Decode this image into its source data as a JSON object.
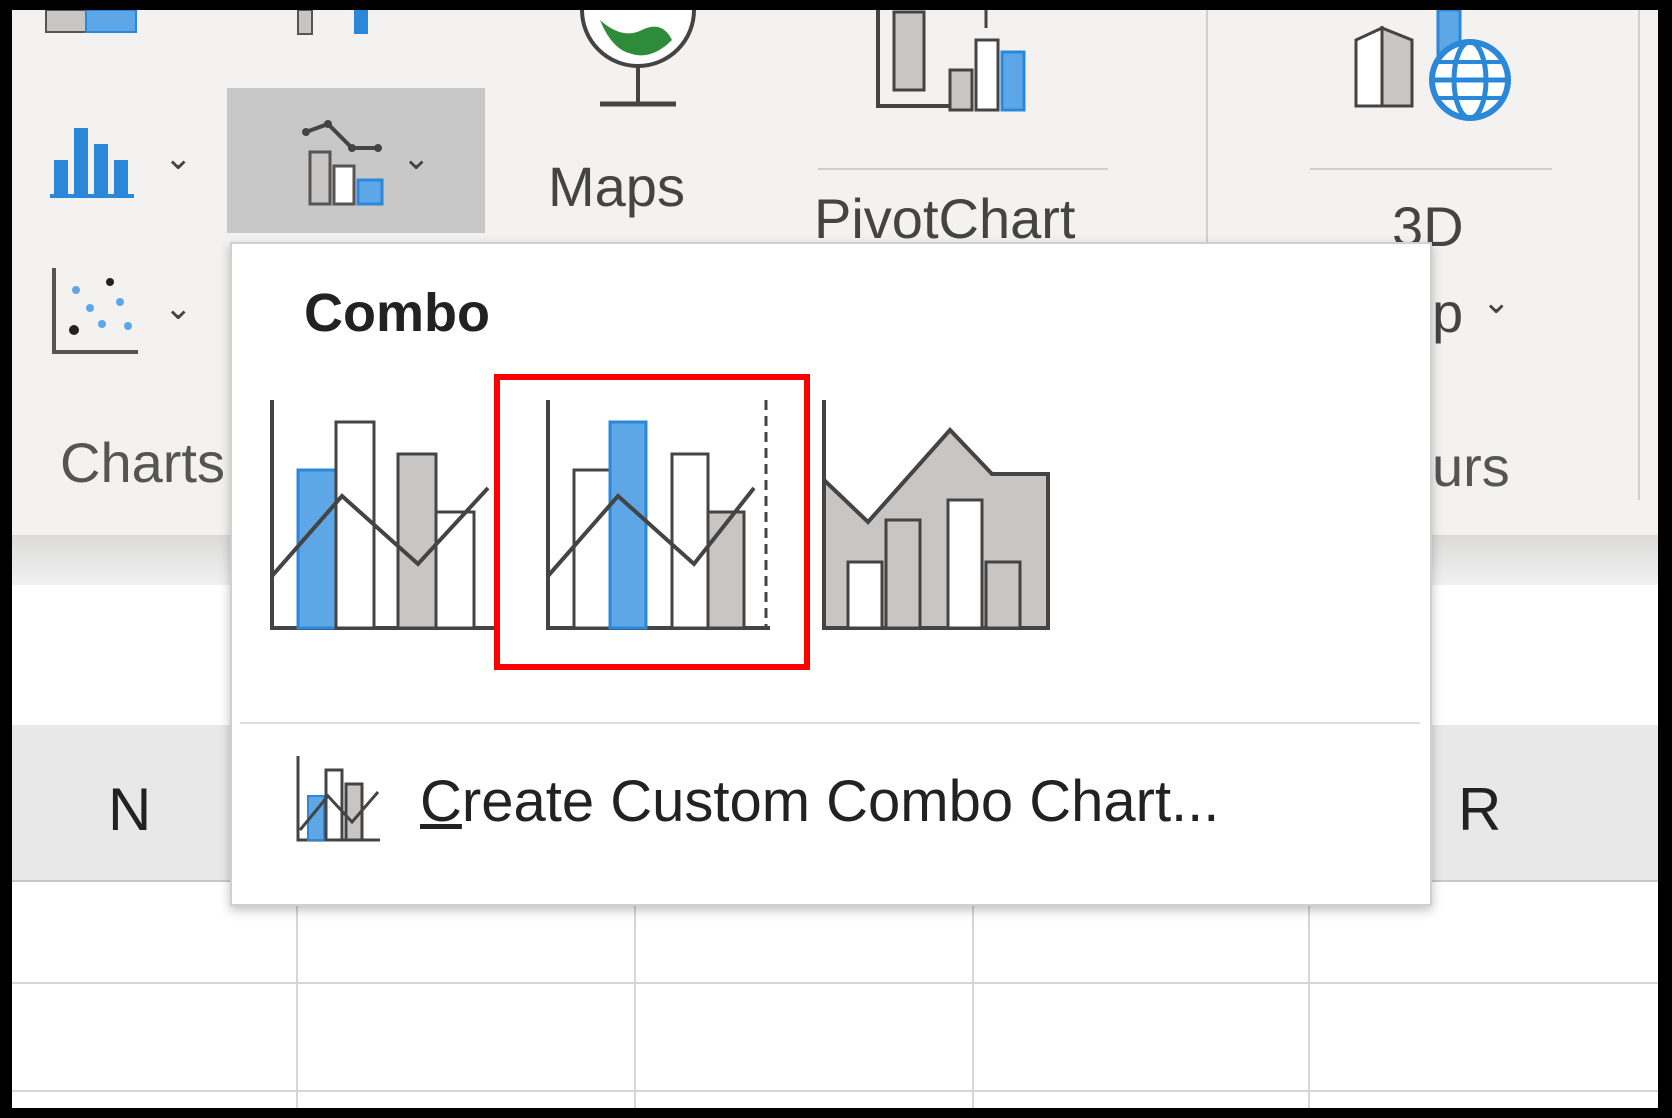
{
  "ribbon": {
    "charts_group_label": "Charts",
    "maps_label": "Maps",
    "pivotchart_label": "PivotChart",
    "map3d_label": "3D",
    "map3d_sub_label": "p",
    "tours_group_label": "urs"
  },
  "sheet": {
    "column_headers": [
      "N",
      "R"
    ]
  },
  "combo_menu": {
    "title": "Combo",
    "options": [
      {
        "name": "Clustered Column - Line",
        "icon": "clustered-column-line-icon"
      },
      {
        "name": "Clustered Column - Line on Secondary Axis",
        "icon": "column-line-secondary-axis-icon",
        "highlighted": true
      },
      {
        "name": "Stacked Area - Clustered Column",
        "icon": "area-column-icon"
      }
    ],
    "custom_label_mnemonic": "C",
    "custom_label_rest": "reate Custom Combo Chart...",
    "highlight_color": "#ff0000"
  },
  "colors": {
    "accent_blue": "#2b88d8",
    "light_blue": "#5ea7e6",
    "gray": "#c8c6c4",
    "ribbon_bg": "#f3f2f1"
  }
}
